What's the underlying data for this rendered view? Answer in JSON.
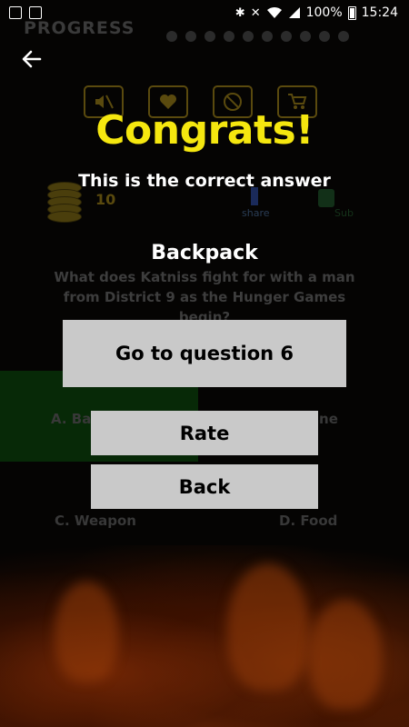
{
  "status_bar": {
    "battery": "100%",
    "time": "15:24"
  },
  "game_background": {
    "progress_label": "PROGRESS",
    "progress_dots_count": 10,
    "coins": "10",
    "share_label": "share",
    "share_label2": "Sub",
    "question_number_hint": "6",
    "question": "What does Katniss fight for with a man from District 9 as the Hunger Games begin?",
    "answers": {
      "a": "A. Backpack",
      "b": "B. Wine",
      "c": "C. Weapon",
      "d": "D. Food"
    },
    "correct_answer_color": "#072907"
  },
  "dialog": {
    "title": "Congrats!",
    "subtitle": "This is the correct answer",
    "answer": "Backpack",
    "next_button": "Go to question 6",
    "rate_button": "Rate",
    "back_button": "Back"
  },
  "colors": {
    "title_yellow": "#f5e70f",
    "button_gray": "#c9c9c9",
    "background": "#050403"
  },
  "icons": [
    "mute-icon",
    "heart-icon",
    "ads-icon",
    "cart-icon",
    "back-arrow-icon",
    "bluetooth-icon",
    "wifi-icon",
    "battery-icon"
  ]
}
